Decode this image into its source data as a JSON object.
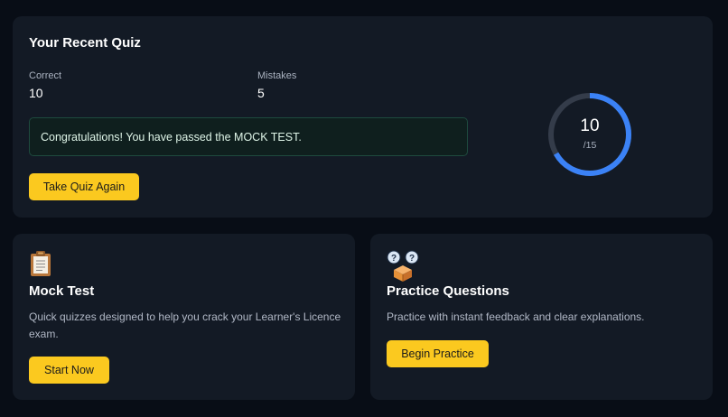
{
  "recent_quiz": {
    "title": "Your Recent Quiz",
    "correct_label": "Correct",
    "correct_value": "10",
    "mistakes_label": "Mistakes",
    "mistakes_value": "5",
    "congrats_message": "Congratulations! You have passed the MOCK TEST.",
    "retake_label": "Take Quiz Again",
    "score": "10",
    "score_total": "/15",
    "score_fraction": 0.6667,
    "ring_color": "#3b82f6",
    "ring_track_color": "#343c4a"
  },
  "mock_test": {
    "icon": "clipboard-icon",
    "title": "Mock Test",
    "description": "Quick quizzes designed to help you crack your Learner's Licence exam.",
    "button_label": "Start Now"
  },
  "practice": {
    "icon": "question-box-icon",
    "title": "Practice Questions",
    "description": "Practice with instant feedback and clear explanations.",
    "button_label": "Begin Practice"
  },
  "colors": {
    "accent": "#fbc91f",
    "background": "#080d16",
    "card": "#131a25"
  }
}
